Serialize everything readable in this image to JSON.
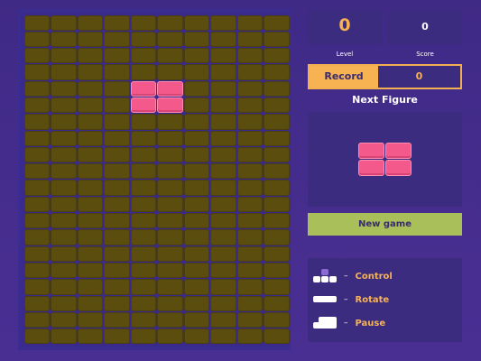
{
  "board": {
    "columns": 10,
    "rows": 20,
    "filled_cells": [
      [
        4,
        4
      ],
      [
        5,
        4
      ],
      [
        4,
        5
      ],
      [
        5,
        5
      ]
    ],
    "empty_color": "#5b4d0d",
    "piece_color": "#f3598b"
  },
  "stats": {
    "level_value": "0",
    "level_label": "Level",
    "score_value": "0",
    "score_label": "Score"
  },
  "record": {
    "label": "Record",
    "value": "0"
  },
  "next_figure": {
    "title": "Next Figure",
    "shape": "O"
  },
  "new_game_label": "New game",
  "controls": [
    {
      "icon": "arrow-keys-icon",
      "label": "Control"
    },
    {
      "icon": "space-key-icon",
      "label": "Rotate"
    },
    {
      "icon": "enter-key-icon",
      "label": "Pause"
    }
  ],
  "colors": {
    "accent": "#f7b252",
    "button": "#a9c05a",
    "background": "#3f2a86"
  }
}
